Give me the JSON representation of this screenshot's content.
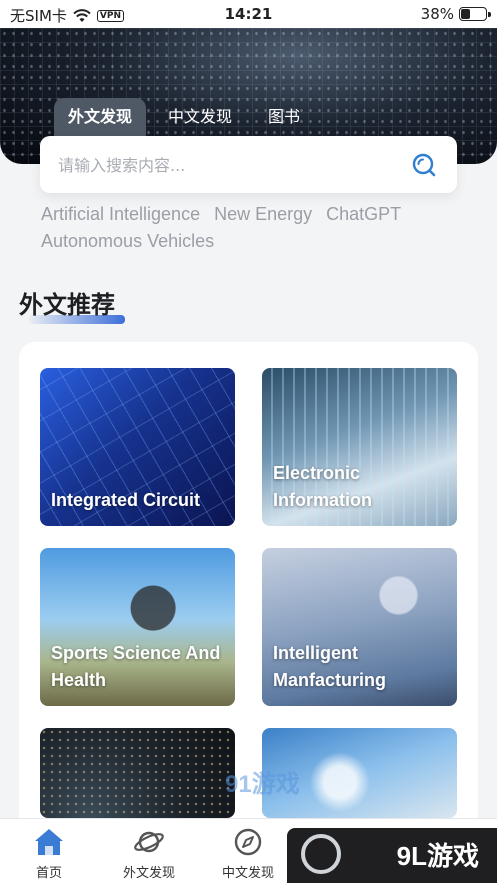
{
  "status_bar": {
    "carrier": "无SIM卡",
    "vpn": "VPN",
    "time": "14:21",
    "battery": "38%",
    "battery_level": 0.38
  },
  "tabs": [
    {
      "label": "外文发现",
      "active": true
    },
    {
      "label": "中文发现",
      "active": false
    },
    {
      "label": "图书",
      "active": false
    }
  ],
  "search": {
    "placeholder": "请输入搜索内容..."
  },
  "hot_tags": [
    "Artificial Intelligence",
    "New Energy",
    "ChatGPT",
    "Autonomous Vehicles"
  ],
  "section": {
    "title": "外文推荐"
  },
  "cards": [
    {
      "label": "Integrated Circuit"
    },
    {
      "label": "Electronic Information"
    },
    {
      "label": "Sports Science And Health"
    },
    {
      "label": "Intelligent Manfacturing"
    },
    {
      "label": ""
    },
    {
      "label": ""
    }
  ],
  "bottom_nav": [
    {
      "label": "首页",
      "icon": "home-icon",
      "active": true
    },
    {
      "label": "外文发现",
      "icon": "planet-icon",
      "active": false
    },
    {
      "label": "中文发现",
      "icon": "compass-icon",
      "active": false
    }
  ],
  "overlay": {
    "watermark": "91游戏",
    "ad_brand": "9L游戏"
  },
  "colors": {
    "accent": "#3d6fd8",
    "search_icon": "#2f7fd1",
    "home_active": "#3a7bd5"
  }
}
